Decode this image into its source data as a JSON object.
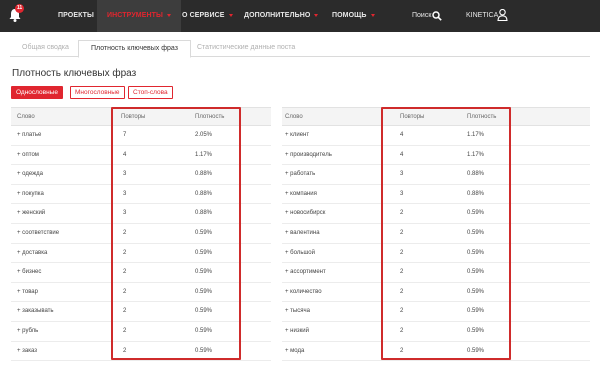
{
  "nav": {
    "notification_count": "11",
    "items": [
      {
        "label": "ПРОЕКТЫ"
      },
      {
        "label": "ИНСТРУМЕНТЫ"
      },
      {
        "label": "О СЕРВИСЕ"
      },
      {
        "label": "ДОПОЛНИТЕЛЬНО"
      },
      {
        "label": "ПОМОЩЬ"
      }
    ],
    "search_label": "Поиск",
    "user_label": "KINETICA",
    "accent_color": "#e0262f",
    "bar_color": "#2b2b2b"
  },
  "tabs": [
    {
      "label": "Общая сводка"
    },
    {
      "label": "Плотность ключевых фраз"
    },
    {
      "label": "Статистические данные поста"
    }
  ],
  "title": "Плотность ключевых фраз",
  "filters": [
    {
      "label": "Однословные"
    },
    {
      "label": "Многословные"
    },
    {
      "label": "Стоп-слова"
    }
  ],
  "table_headers": {
    "word": "Слово",
    "count": "Повторы",
    "density": "Плотность"
  },
  "left_table": [
    {
      "word": "+ платье",
      "count": "7",
      "density": "2.05%"
    },
    {
      "word": "+ оптом",
      "count": "4",
      "density": "1.17%"
    },
    {
      "word": "+ одежда",
      "count": "3",
      "density": "0.88%"
    },
    {
      "word": "+ покупка",
      "count": "3",
      "density": "0.88%"
    },
    {
      "word": "+ женский",
      "count": "3",
      "density": "0.88%"
    },
    {
      "word": "+ соответствие",
      "count": "2",
      "density": "0.59%"
    },
    {
      "word": "+ доставка",
      "count": "2",
      "density": "0.59%"
    },
    {
      "word": "+ бизнес",
      "count": "2",
      "density": "0.59%"
    },
    {
      "word": "+ товар",
      "count": "2",
      "density": "0.59%"
    },
    {
      "word": "+ заказывать",
      "count": "2",
      "density": "0.59%"
    },
    {
      "word": "+ рубль",
      "count": "2",
      "density": "0.59%"
    },
    {
      "word": "+ заказ",
      "count": "2",
      "density": "0.59%"
    }
  ],
  "right_table": [
    {
      "word": "+ клиент",
      "count": "4",
      "density": "1.17%"
    },
    {
      "word": "+ производитель",
      "count": "4",
      "density": "1.17%"
    },
    {
      "word": "+ работать",
      "count": "3",
      "density": "0.88%"
    },
    {
      "word": "+ компания",
      "count": "3",
      "density": "0.88%"
    },
    {
      "word": "+ новосибирск",
      "count": "2",
      "density": "0.59%"
    },
    {
      "word": "+ валентина",
      "count": "2",
      "density": "0.59%"
    },
    {
      "word": "+ большой",
      "count": "2",
      "density": "0.59%"
    },
    {
      "word": "+ ассортимент",
      "count": "2",
      "density": "0.59%"
    },
    {
      "word": "+ количество",
      "count": "2",
      "density": "0.59%"
    },
    {
      "word": "+ тысяча",
      "count": "2",
      "density": "0.59%"
    },
    {
      "word": "+ низкий",
      "count": "2",
      "density": "0.59%"
    },
    {
      "word": "+ мода",
      "count": "2",
      "density": "0.59%"
    }
  ]
}
